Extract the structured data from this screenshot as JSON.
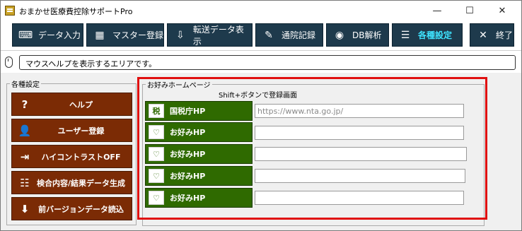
{
  "window": {
    "title": "おまかせ医療費控除サポートPro",
    "minimize": "—",
    "maximize": "☐",
    "close": "✕"
  },
  "toolbar": [
    {
      "label": "データ入力",
      "icon": "keyboard-icon",
      "glyph": "⌨"
    },
    {
      "label": "マスター登録",
      "icon": "database-icon",
      "glyph": "▦"
    },
    {
      "label": "転送データ表示",
      "icon": "usb-icon",
      "glyph": "⇩"
    },
    {
      "label": "通院記録",
      "icon": "clipboard-icon",
      "glyph": "✎"
    },
    {
      "label": "DB解析",
      "icon": "db-icon",
      "glyph": "◉"
    },
    {
      "label": "各種設定",
      "icon": "menu-icon",
      "glyph": "☰",
      "active": true
    },
    {
      "label": "終了",
      "icon": "close-icon",
      "glyph": "✕"
    }
  ],
  "help_text": "マウスヘルプを表示するエリアです。",
  "settings_group": {
    "legend": "各種設定",
    "buttons": [
      {
        "label": "ヘルプ",
        "icon": "question-icon",
        "glyph": "?"
      },
      {
        "label": "ユーザー登録",
        "icon": "user-icon",
        "glyph": "👤"
      },
      {
        "label": "ハイコントラストOFF",
        "icon": "logout-icon",
        "glyph": "⇥"
      },
      {
        "label": "検合内容/結果データ生成",
        "icon": "document-icon",
        "glyph": "☷"
      },
      {
        "label": "前バージョンデータ読込",
        "icon": "import-icon",
        "glyph": "⬇"
      }
    ]
  },
  "homepage_group": {
    "legend": "お好みホームページ",
    "note": "Shift+ボタンで登録画面",
    "items": [
      {
        "label": "国税庁HP",
        "icon_text": "税",
        "url": "https://www.nta.go.jp/"
      },
      {
        "label": "お好みHP",
        "icon_text": "♡",
        "url": ""
      },
      {
        "label": "お好みHP",
        "icon_text": "♡",
        "url": ""
      },
      {
        "label": "お好みHP",
        "icon_text": "♡",
        "url": ""
      },
      {
        "label": "お好みHP",
        "icon_text": "♡",
        "url": ""
      }
    ]
  },
  "colors": {
    "toolbar_bg": "#1e3a4c",
    "active_text": "#3ee3ff",
    "settings_button": "#7b2b05",
    "homepage_button": "#2f6a00",
    "highlight": "#e01010"
  }
}
